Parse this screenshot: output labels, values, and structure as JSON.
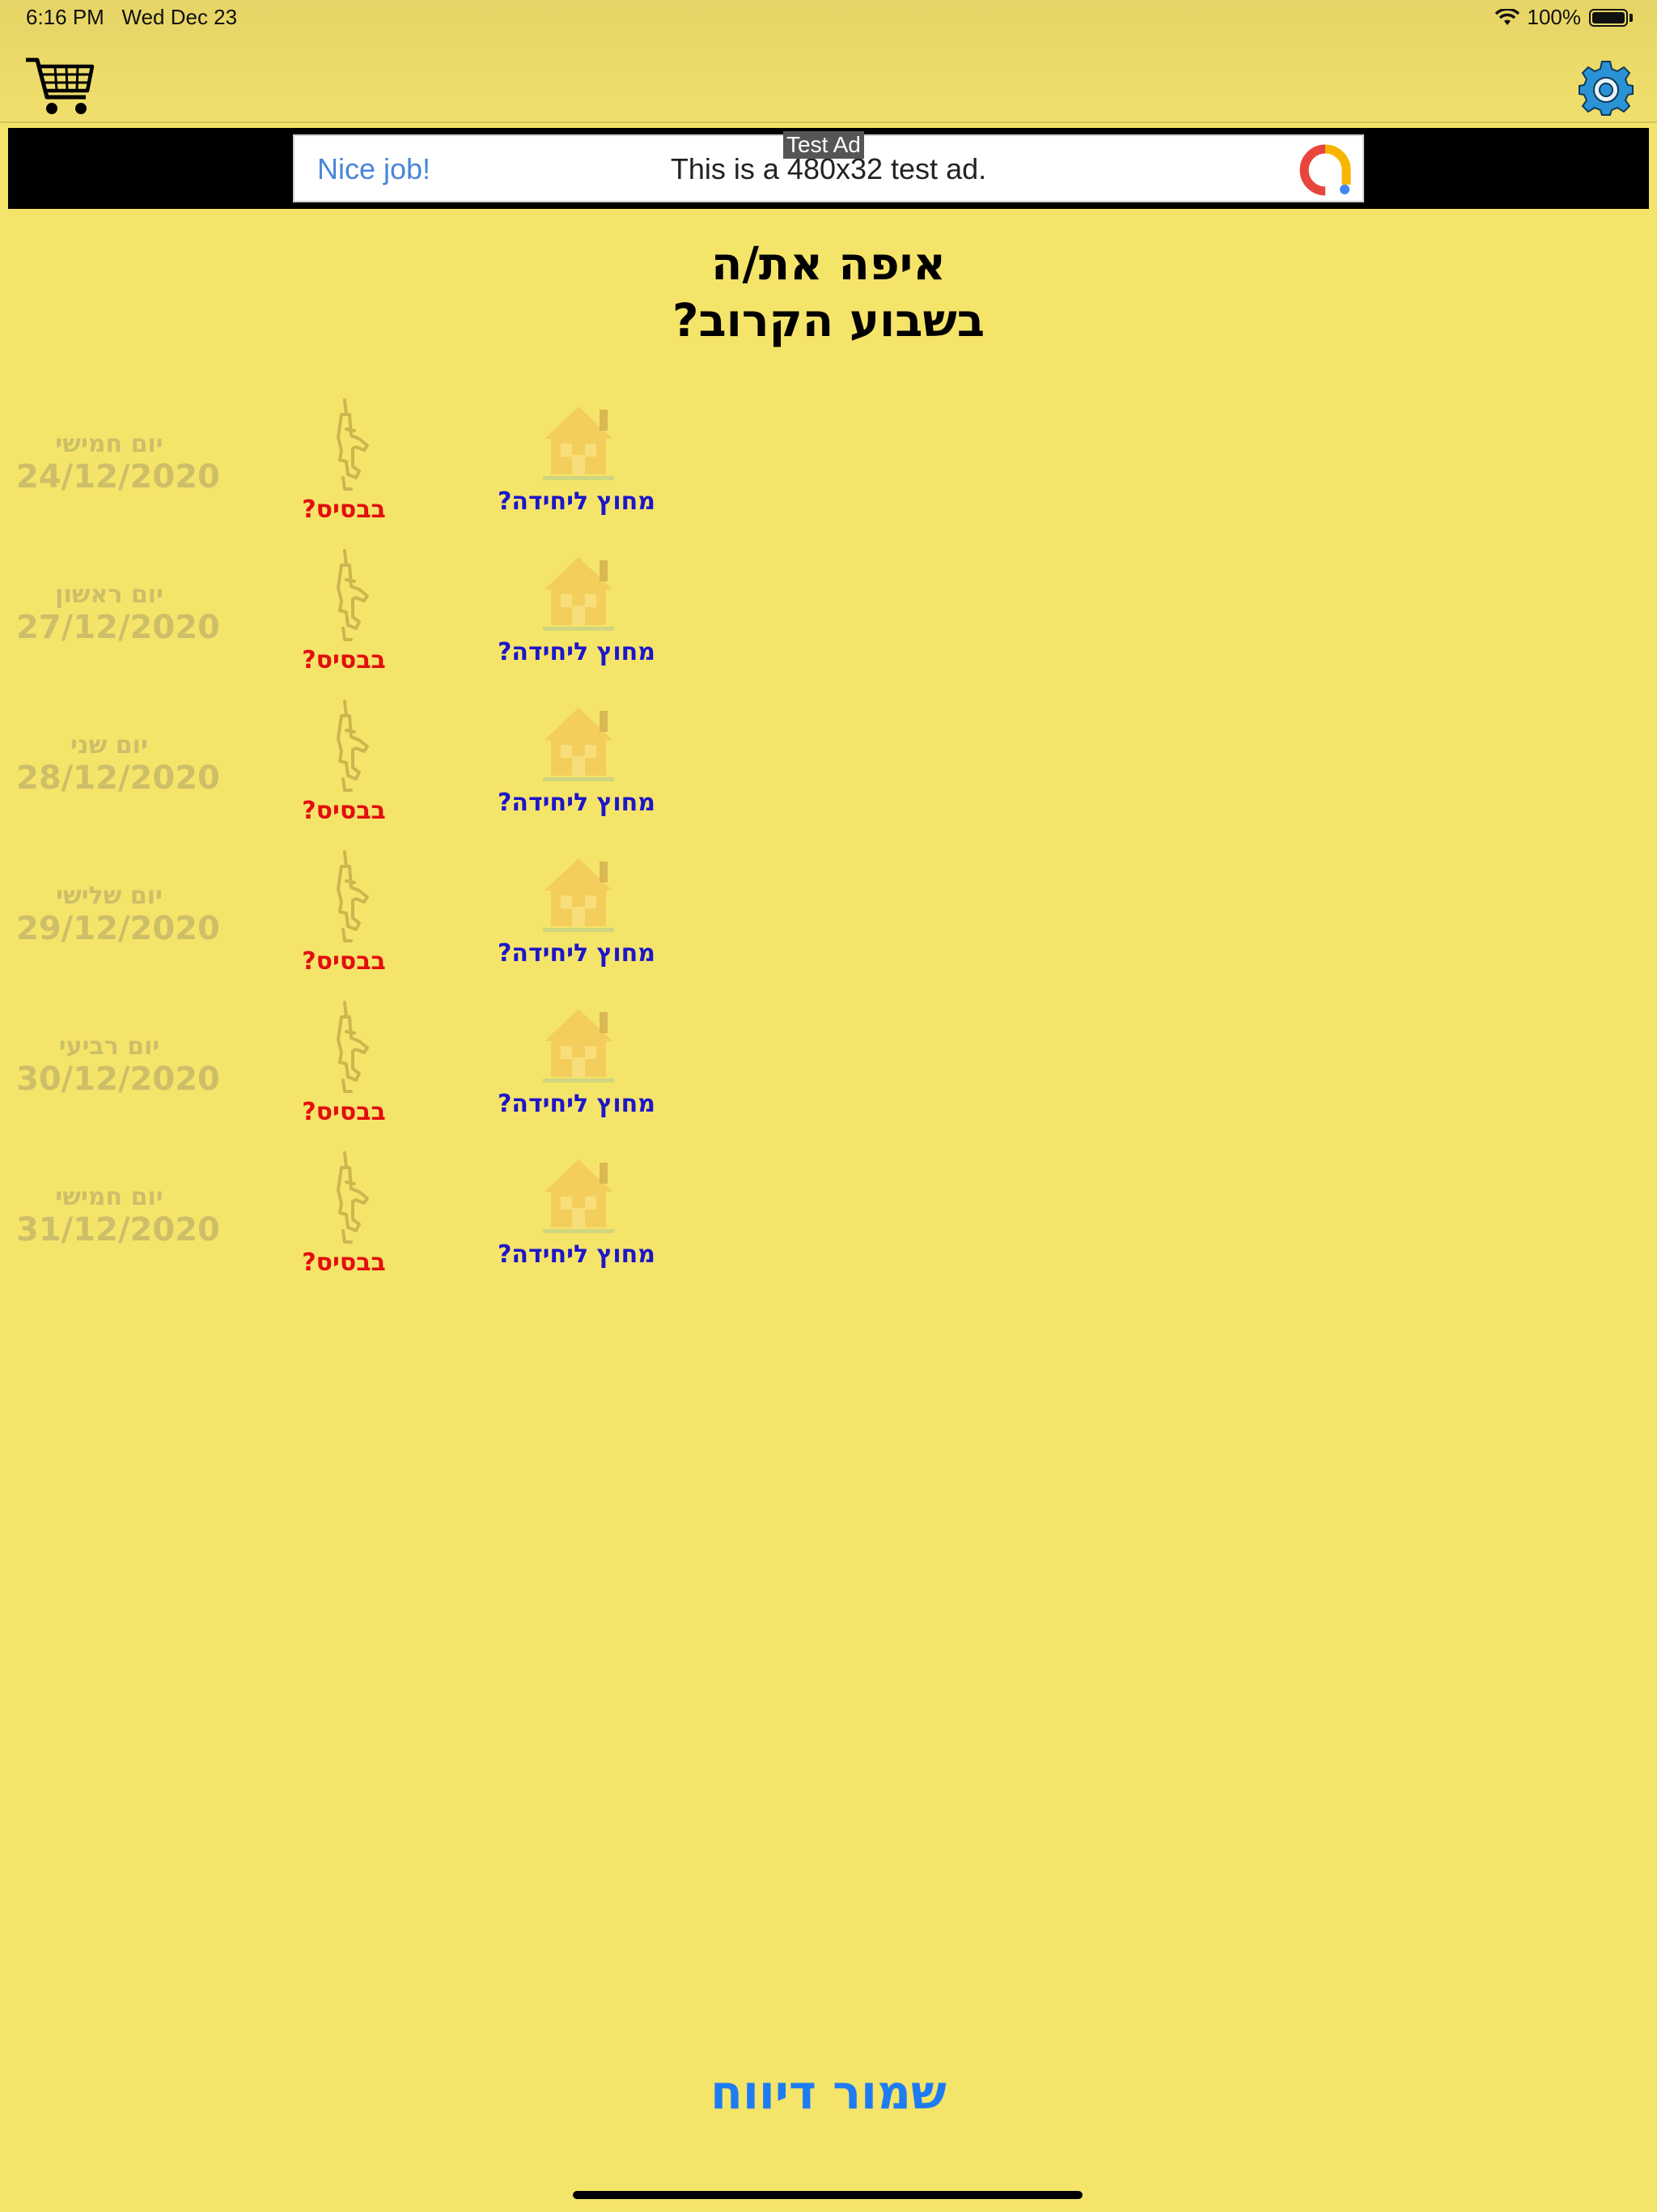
{
  "status_bar": {
    "time": "6:16 PM",
    "date": "Wed Dec 23",
    "battery": "100%"
  },
  "nav": {
    "cart_icon": "shopping-cart-icon",
    "settings_icon": "gear-icon"
  },
  "ad": {
    "badge": "Test Ad",
    "headline": "Nice job!",
    "text": "This is a 480x32 test ad."
  },
  "title": {
    "line1": "איפה את/ה",
    "line2": "בשבוע הקרוב?"
  },
  "days": [
    {
      "name": "יום חמישי",
      "date": "24/12/2020",
      "base_label": "בבסיס?",
      "home_label": "מחוץ ליחידה?"
    },
    {
      "name": "יום ראשון",
      "date": "27/12/2020",
      "base_label": "בבסיס?",
      "home_label": "מחוץ ליחידה?"
    },
    {
      "name": "יום שני",
      "date": "28/12/2020",
      "base_label": "בבסיס?",
      "home_label": "מחוץ ליחידה?"
    },
    {
      "name": "יום שלישי",
      "date": "29/12/2020",
      "base_label": "בבסיס?",
      "home_label": "מחוץ ליחידה?"
    },
    {
      "name": "יום רביעי",
      "date": "30/12/2020",
      "base_label": "בבסיס?",
      "home_label": "מחוץ ליחידה?"
    },
    {
      "name": "יום חמישי",
      "date": "31/12/2020",
      "base_label": "בבסיס?",
      "home_label": "מחוץ ליחידה?"
    }
  ],
  "save_button": "שמור דיווח",
  "colors": {
    "background": "#f5e46a",
    "base_label": "#e20e0e",
    "home_label": "#1c16c8",
    "save_button": "#1e7cf2"
  }
}
